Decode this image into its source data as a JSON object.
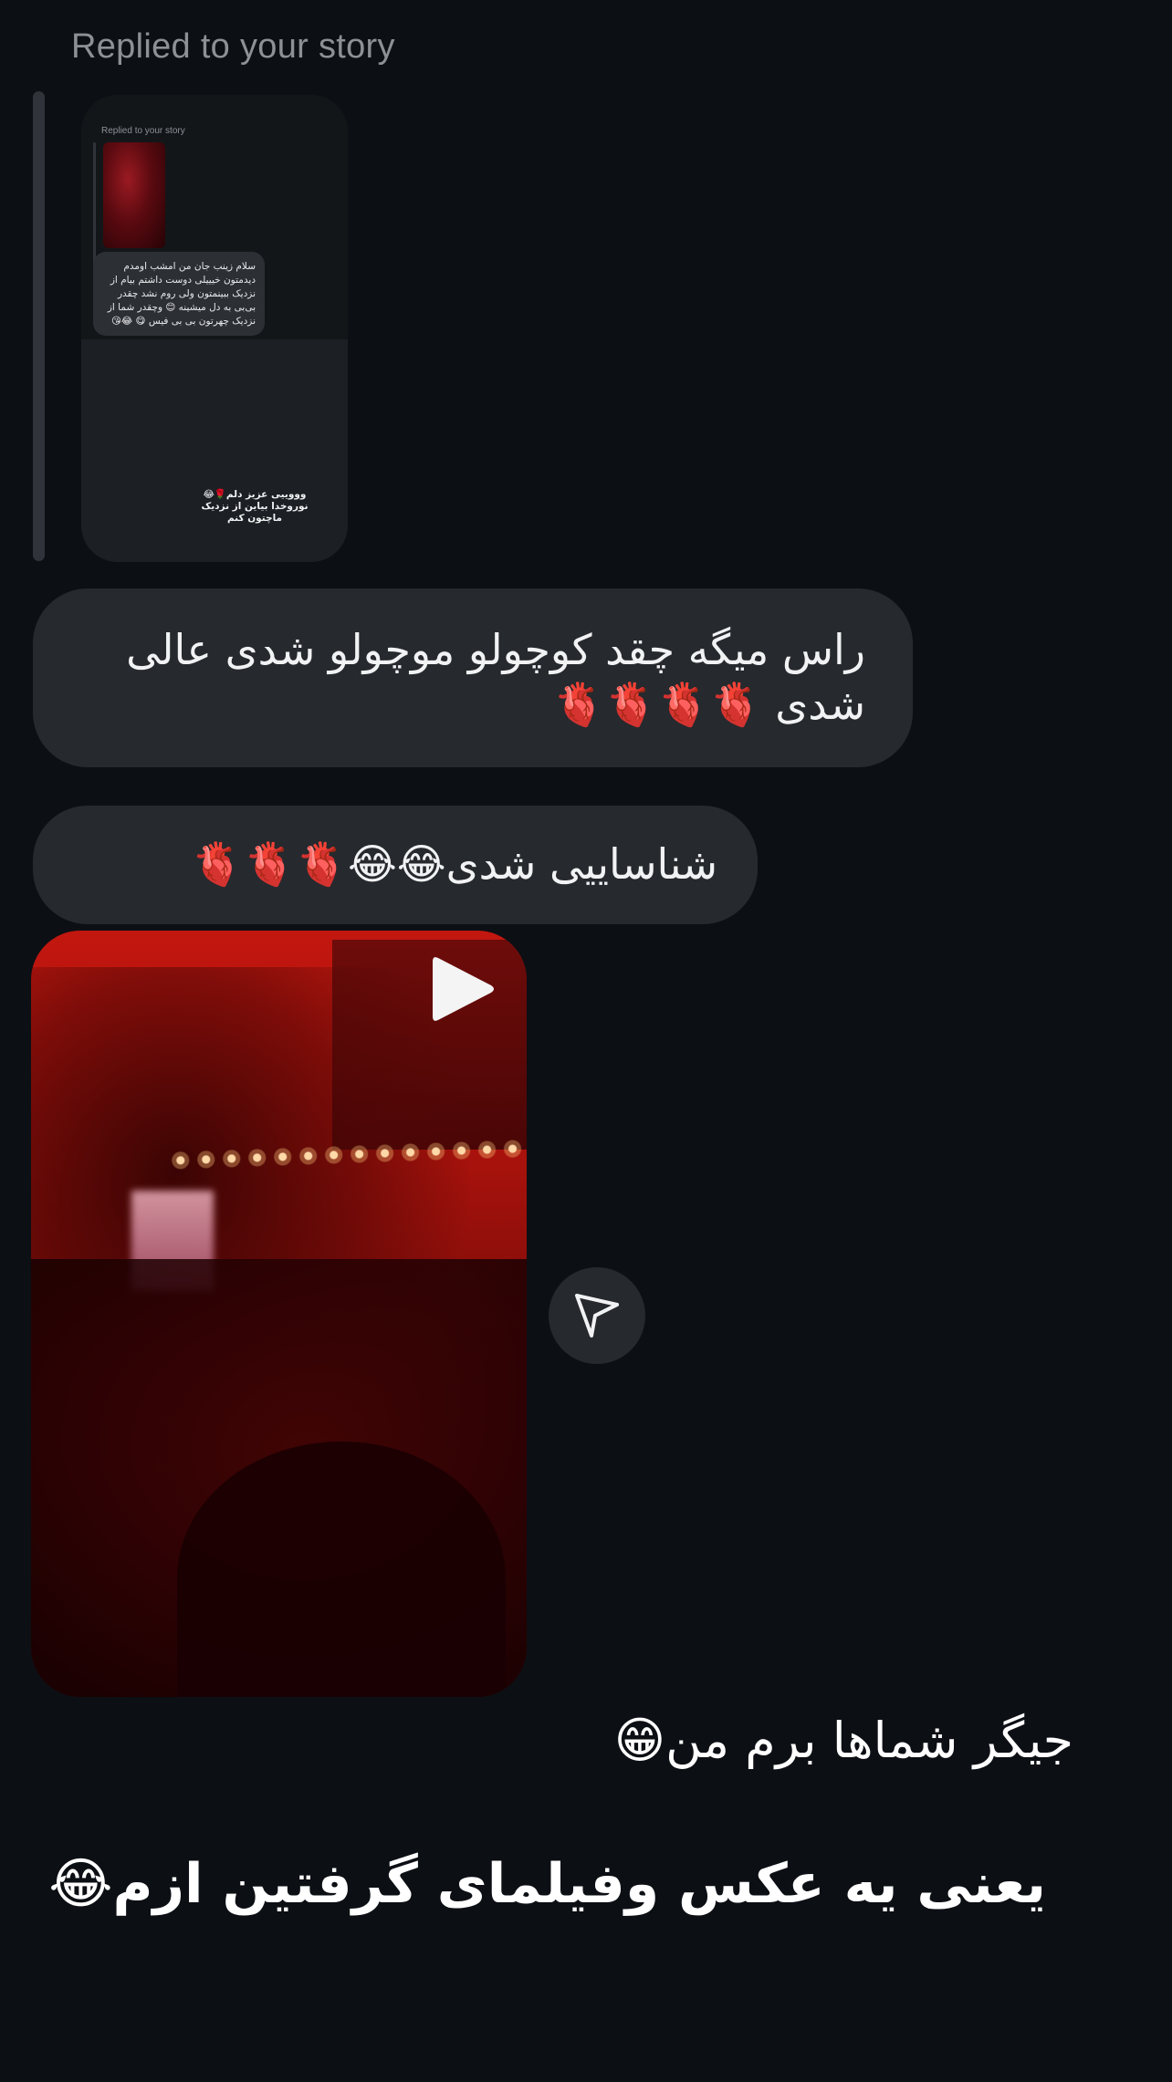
{
  "thread": {
    "replied_label": "Replied to your story"
  },
  "story_reply_preview": {
    "mini_replied_label": "Replied to your story",
    "mini_message": "سلام زینب جان من امشب اومدم دیدمتون خیییلی دوست داشتم بیام از نزدیک ببینمتون ولی روم نشد چقدر بی‌بی به دل میشینه 😊 وچقدر شما از نزدیک چهرتون بی بی فیس 😋 😂😘",
    "mini_caption": "وووییی عزیز دلم🌹😂 نوروخدا بیاین از نزدیک ماچتون کنم"
  },
  "messages": [
    {
      "type": "bubble",
      "text": "راس میگه چقد کوچولو موچولو شدی  عالی شدی 🫀🫀🫀🫀"
    },
    {
      "type": "bubble",
      "text": "شناساییی شدی😂😂🫀🫀🫀"
    },
    {
      "type": "video",
      "play_icon": "play-icon",
      "share_icon": "send-icon"
    },
    {
      "type": "plain",
      "text": "جیگر شماها برم من😁"
    },
    {
      "type": "plain",
      "text": "یعنی یه عکس وفیلمای گرفتین ازم😂"
    }
  ],
  "colors": {
    "background": "#0c0f14",
    "bubble": "#26292d",
    "muted_text": "#8d9196"
  }
}
